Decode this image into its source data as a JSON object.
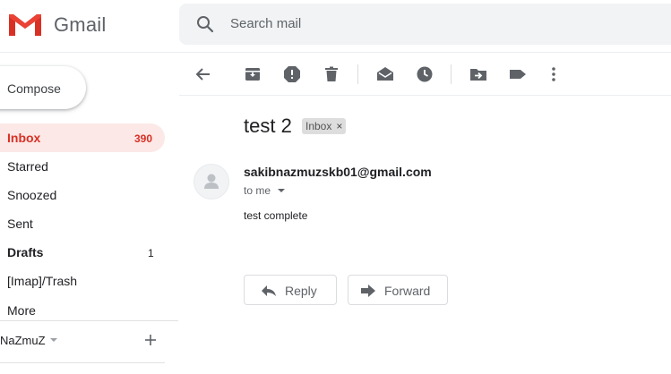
{
  "header": {
    "brand": "Gmail",
    "search_placeholder": "Search mail",
    "colors": {
      "logo_red": "#d93025",
      "search_bg": "#f1f3f4"
    }
  },
  "sidebar": {
    "compose_label": "Compose",
    "items": [
      {
        "label": "Inbox",
        "count": "390",
        "active": true,
        "bold": true
      },
      {
        "label": "Starred",
        "count": ""
      },
      {
        "label": "Snoozed",
        "count": ""
      },
      {
        "label": "Sent",
        "count": ""
      },
      {
        "label": "Drafts",
        "count": "1",
        "bold": true
      },
      {
        "label": "[Imap]/Trash",
        "count": ""
      },
      {
        "label": "More",
        "count": ""
      }
    ],
    "account": "NaZmuZ"
  },
  "toolbar": {
    "icons": [
      "back-arrow-icon",
      "archive-icon",
      "report-spam-icon",
      "delete-icon",
      "mark-unread-icon",
      "snooze-icon",
      "move-to-icon",
      "label-icon",
      "more-vert-icon"
    ]
  },
  "message": {
    "subject": "test 2",
    "label_chip": "Inbox",
    "label_chip_close": "×",
    "sender": "sakibnazmuzskb01@gmail.com",
    "recipient_line": "to me",
    "body": "test complete",
    "reply_label": "Reply",
    "forward_label": "Forward"
  }
}
